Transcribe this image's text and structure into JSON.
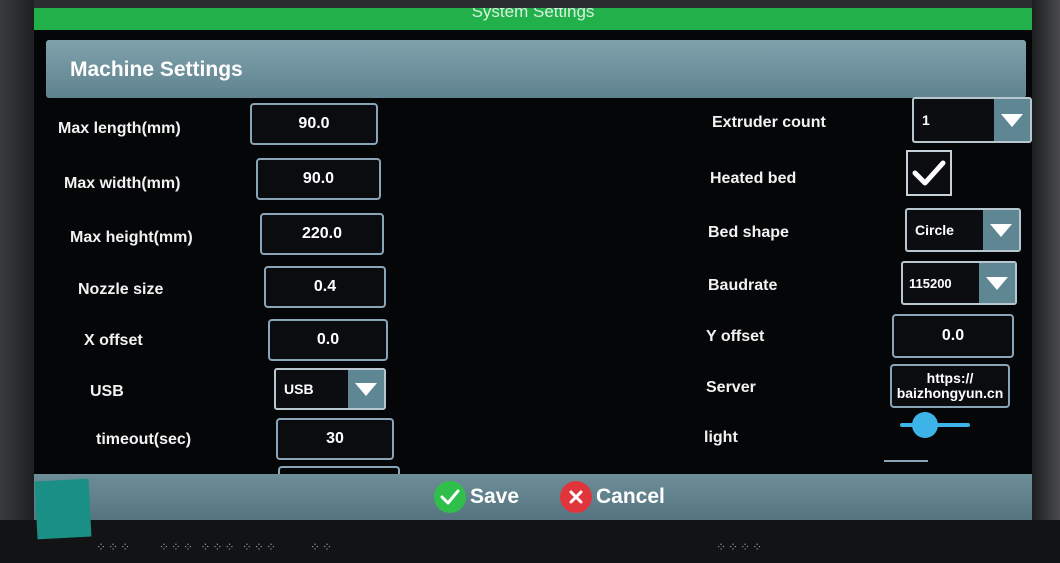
{
  "window": {
    "title": "System Settings"
  },
  "section": {
    "title": "Machine Settings"
  },
  "left_fields": [
    {
      "label": "Max length(mm)",
      "value": "90.0"
    },
    {
      "label": "Max width(mm)",
      "value": "90.0"
    },
    {
      "label": "Max height(mm)",
      "value": "220.0"
    },
    {
      "label": "Nozzle size",
      "value": "0.4"
    },
    {
      "label": "X offset",
      "value": "0.0"
    },
    {
      "label": "USB",
      "value": "USB"
    },
    {
      "label": "timeout(sec)",
      "value": "30"
    }
  ],
  "right_fields": {
    "extruder_count": {
      "label": "Extruder count",
      "value": "1"
    },
    "heated_bed": {
      "label": "Heated bed",
      "checked": true
    },
    "bed_shape": {
      "label": "Bed shape",
      "value": "Circle"
    },
    "baudrate": {
      "label": "Baudrate",
      "value": "115200"
    },
    "y_offset": {
      "label": "Y offset",
      "value": "0.0"
    },
    "server": {
      "label": "Server",
      "line1": "https://",
      "line2": "baizhongyun.cn"
    },
    "light": {
      "label": "light",
      "level": 0.35
    }
  },
  "footer": {
    "save_label": "Save",
    "cancel_label": "Cancel"
  },
  "colors": {
    "titlebar": "#22b04a",
    "header": "#6f929d",
    "accent": "#3db4e8",
    "save": "#2fbf4a",
    "cancel": "#e0353d"
  },
  "icons": {
    "check": "check-icon",
    "dropdown": "chevron-down-icon",
    "save": "check-circle-icon",
    "cancel": "x-circle-icon"
  }
}
